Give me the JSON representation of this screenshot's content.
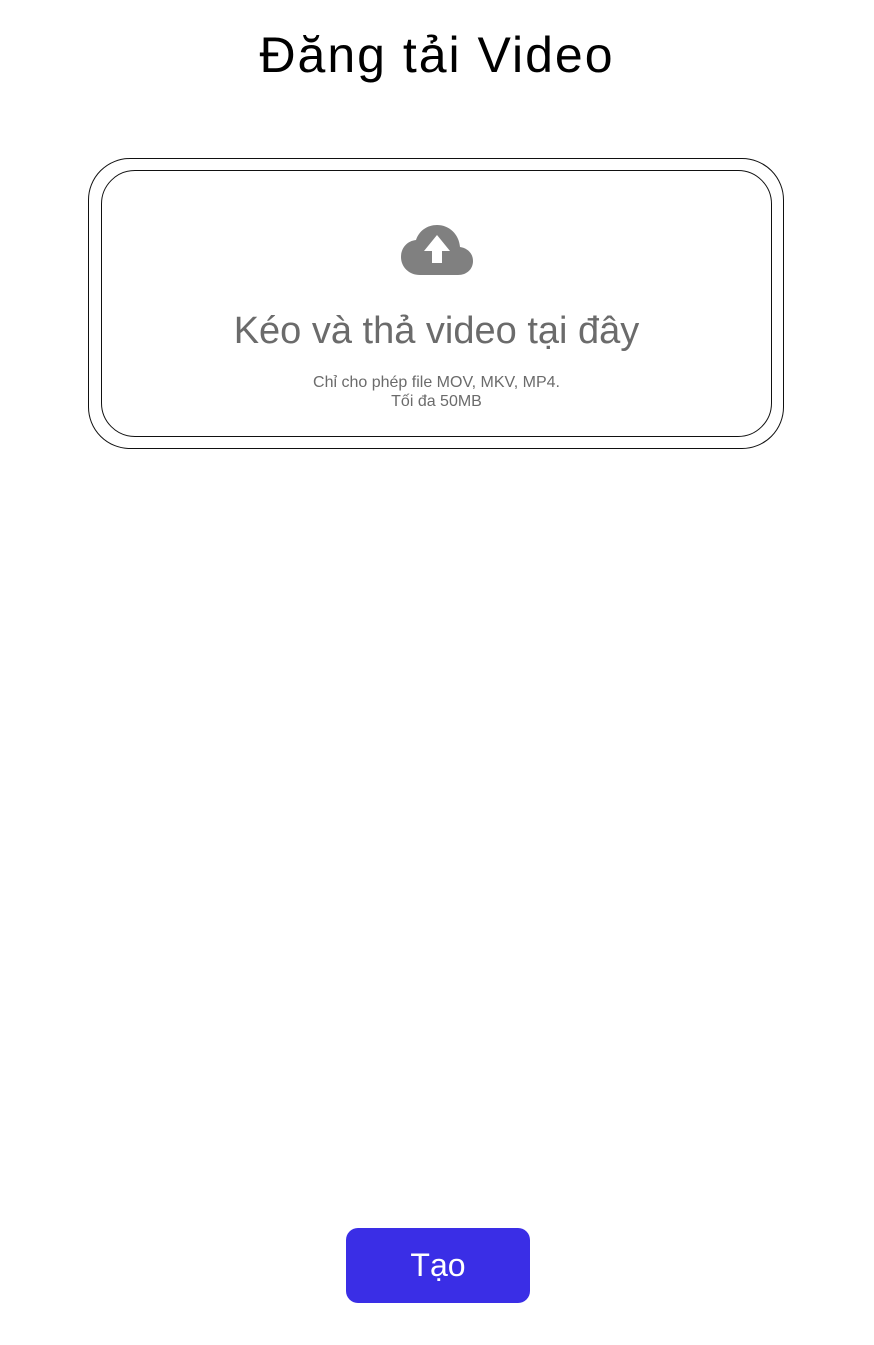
{
  "header": {
    "title": "Đăng tải Video"
  },
  "dropzone": {
    "icon": "cloud-upload-icon",
    "title": "Kéo và thả video tại đây",
    "hint_formats": "Chỉ cho phép file MOV, MKV, MP4.",
    "hint_size": "Tối đa 50MB",
    "icon_color": "#808080",
    "text_color": "#6b6b6b",
    "border_color": "#111111"
  },
  "actions": {
    "create_label": "Tạo",
    "create_color": "#3a2ee6"
  }
}
